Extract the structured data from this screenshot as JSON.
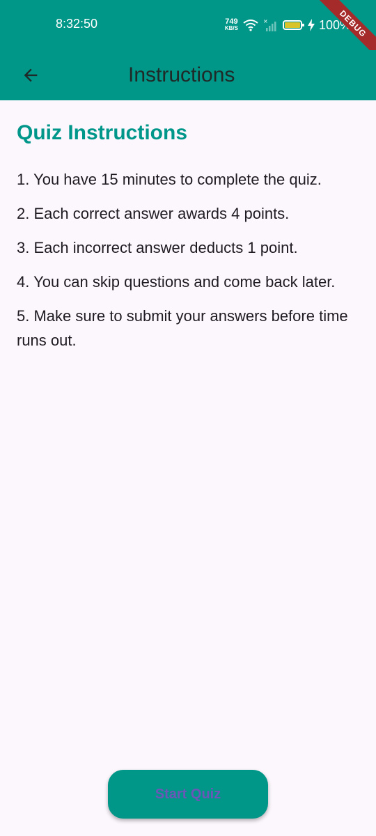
{
  "status_bar": {
    "time": "8:32:50",
    "net_speed_value": "749",
    "net_speed_unit": "KB/S",
    "battery_percent": "100%",
    "debug_label": "DEBUG"
  },
  "app_bar": {
    "title": "Instructions",
    "back_icon": "arrow-back-icon"
  },
  "main": {
    "heading": "Quiz Instructions",
    "rules": [
      "1. You have 15 minutes to complete the quiz.",
      "2. Each correct answer awards 4 points.",
      "3. Each incorrect answer deducts 1 point.",
      "4. You can skip questions and come back later.",
      "5. Make sure to submit your answers before time runs out."
    ]
  },
  "footer": {
    "start_label": "Start Quiz"
  },
  "colors": {
    "primary": "#009688",
    "heading": "#00968A",
    "button_text": "#6A57B8",
    "background": "#FCF7FD"
  }
}
